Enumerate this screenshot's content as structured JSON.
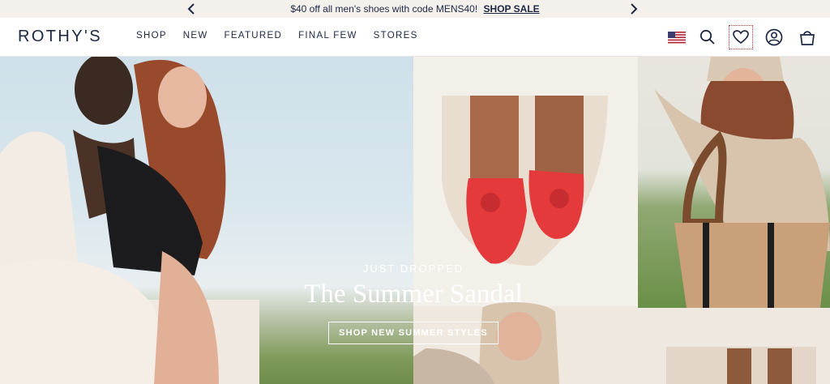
{
  "promo": {
    "message": "$40 off all men's shoes with code MENS40!",
    "link": "SHOP SALE"
  },
  "header": {
    "logo": "ROTHY'S",
    "nav": [
      "SHOP",
      "NEW",
      "FEATURED",
      "FINAL FEW",
      "STORES"
    ]
  },
  "hero": {
    "eyebrow": "JUST DROPPED",
    "headline": "The Summer Sandal",
    "cta": "SHOP NEW SUMMER STYLES"
  },
  "colors": {
    "navy": "#1d2744",
    "promo_bg": "#f4f1ec",
    "sandal_red": "#e53a3c"
  }
}
